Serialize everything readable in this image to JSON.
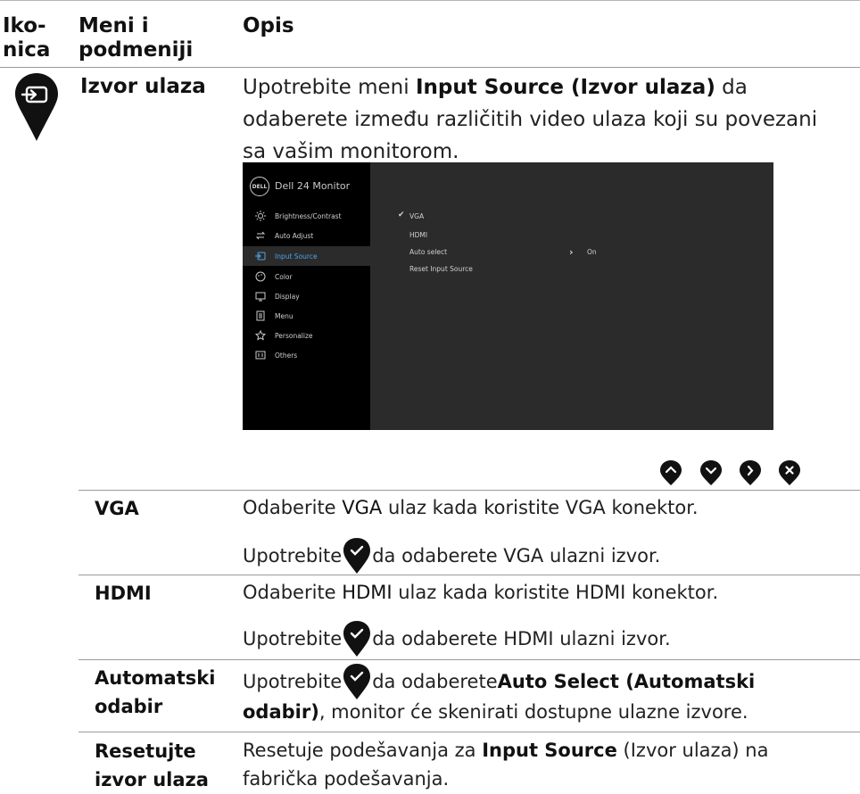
{
  "header": {
    "col1": "Iko-\nnica",
    "col2": "Meni i\npodmeniji",
    "col3": "Opis"
  },
  "main_row": {
    "title": "Izvor ulaza",
    "desc_before": "Upotrebite meni ",
    "desc_bold": "Input Source (Izvor ulaza)",
    "desc_after": " da odaberete između različitih video ulaza koji su povezani sa vašim monitorom."
  },
  "osd": {
    "logo": "DELL",
    "title": "Dell 24 Monitor",
    "menu": [
      "Brightness/Contrast",
      "Auto Adjust",
      "Input Source",
      "Color",
      "Display",
      "Menu",
      "Personalize",
      "Others"
    ],
    "options": [
      "VGA",
      "HDMI",
      "Auto select",
      "Reset Input Source"
    ],
    "auto_value": "On"
  },
  "rows": [
    {
      "label": "VGA",
      "line1_pre": "Odaberite ",
      "line1_bold": "VGA",
      "line1_post": " ulaz kada koristite VGA konektor.",
      "line2_pre": "Upotrebite ",
      "line2_post": " da odaberete VGA ulazni izvor."
    },
    {
      "label": "HDMI",
      "line1_pre": "Odaberite ",
      "line1_bold": "HDMI",
      "line1_post": " ulaz kada koristite HDMI konektor.",
      "line2_pre": "Upotrebite ",
      "line2_post": " da odaberete HDMI ulazni izvor."
    },
    {
      "label": "Automatski\nodabir",
      "line1_pre": "Upotrebite ",
      "line1_mid": " da odaberete ",
      "line1_bold": "Auto Select (Automatski",
      "line2_bold": "odabir)",
      "line2_post": ", monitor će skenirati dostupne ulazne izvore."
    },
    {
      "label": "Resetujte\nizvor ulaza",
      "line1_pre": "Resetuje podešavanja za ",
      "line1_bold": "Input Source",
      "line1_post": " (Izvor ulaza) na",
      "line2": "fabrička podešavanja."
    }
  ],
  "colors": {
    "marker": "#111111",
    "osd_bg": "#2b2b2b",
    "osd_accent": "#4fa3e8"
  },
  "icons": [
    "input-source-marker-icon",
    "up-nav-icon",
    "down-nav-icon",
    "right-nav-icon",
    "close-nav-icon",
    "check-icon"
  ]
}
